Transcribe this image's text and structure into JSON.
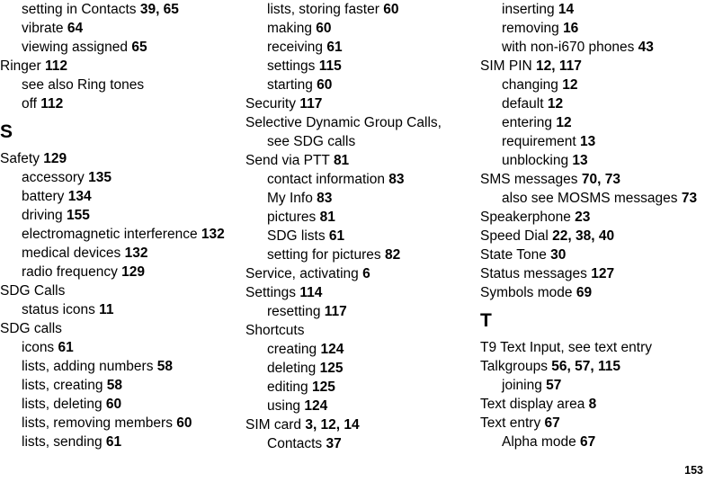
{
  "document": {
    "type": "index",
    "page_number": "153"
  },
  "columns": [
    {
      "name": "column-1",
      "entries": [
        {
          "level": 1,
          "text": "setting in Contacts",
          "pages": "39, 65"
        },
        {
          "level": 1,
          "text": "vibrate",
          "pages": "64"
        },
        {
          "level": 1,
          "text": "viewing assigned",
          "pages": "65"
        },
        {
          "level": 0,
          "text": "Ringer",
          "pages": "112"
        },
        {
          "level": 1,
          "text": "see also Ring tones",
          "pages": ""
        },
        {
          "level": 1,
          "text": "off",
          "pages": "112"
        },
        {
          "heading": "S"
        },
        {
          "level": 0,
          "text": "Safety",
          "pages": "129"
        },
        {
          "level": 1,
          "text": "accessory",
          "pages": "135"
        },
        {
          "level": 1,
          "text": "battery",
          "pages": "134"
        },
        {
          "level": 1,
          "text": "driving",
          "pages": "155"
        },
        {
          "level": 1,
          "text": "electromagnetic interference",
          "pages": "132",
          "wrap": true
        },
        {
          "level": 1,
          "text": "medical devices",
          "pages": "132"
        },
        {
          "level": 1,
          "text": "radio frequency",
          "pages": "129"
        },
        {
          "level": 0,
          "text": "SDG Calls",
          "pages": ""
        },
        {
          "level": 1,
          "text": "status icons",
          "pages": "11"
        },
        {
          "level": 0,
          "text": "SDG calls",
          "pages": ""
        },
        {
          "level": 1,
          "text": "icons",
          "pages": "61"
        },
        {
          "level": 1,
          "text": "lists, adding numbers",
          "pages": "58"
        },
        {
          "level": 1,
          "text": "lists, creating",
          "pages": "58"
        },
        {
          "level": 1,
          "text": "lists, deleting",
          "pages": "60"
        },
        {
          "level": 1,
          "text": "lists, removing members",
          "pages": "60"
        },
        {
          "level": 1,
          "text": "lists, sending",
          "pages": "61"
        }
      ]
    },
    {
      "name": "column-2",
      "entries": [
        {
          "level": 1,
          "text": "lists, storing faster",
          "pages": "60"
        },
        {
          "level": 1,
          "text": "making",
          "pages": "60"
        },
        {
          "level": 1,
          "text": "receiving",
          "pages": "61"
        },
        {
          "level": 1,
          "text": "settings",
          "pages": "115"
        },
        {
          "level": 1,
          "text": "starting",
          "pages": "60"
        },
        {
          "level": 0,
          "text": "Security",
          "pages": "117"
        },
        {
          "level": 0,
          "text": "Selective Dynamic Group Calls, see SDG calls",
          "pages": "",
          "wrap": true
        },
        {
          "level": 0,
          "text": "Send via PTT",
          "pages": "81"
        },
        {
          "level": 1,
          "text": "contact information",
          "pages": "83"
        },
        {
          "level": 1,
          "text": "My Info",
          "pages": "83"
        },
        {
          "level": 1,
          "text": "pictures",
          "pages": "81"
        },
        {
          "level": 1,
          "text": "SDG lists",
          "pages": "61"
        },
        {
          "level": 1,
          "text": "setting for pictures",
          "pages": "82"
        },
        {
          "level": 0,
          "text": "Service, activating",
          "pages": "6"
        },
        {
          "level": 0,
          "text": "Settings",
          "pages": "114"
        },
        {
          "level": 1,
          "text": "resetting",
          "pages": "117"
        },
        {
          "level": 0,
          "text": "Shortcuts",
          "pages": ""
        },
        {
          "level": 1,
          "text": "creating",
          "pages": "124"
        },
        {
          "level": 1,
          "text": "deleting",
          "pages": "125"
        },
        {
          "level": 1,
          "text": "editing",
          "pages": "125"
        },
        {
          "level": 1,
          "text": "using",
          "pages": "124"
        },
        {
          "level": 0,
          "text": "SIM card",
          "pages": "3, 12, 14"
        },
        {
          "level": 1,
          "text": "Contacts",
          "pages": "37"
        }
      ]
    },
    {
      "name": "column-3",
      "entries": [
        {
          "level": 1,
          "text": "inserting",
          "pages": "14"
        },
        {
          "level": 1,
          "text": "removing",
          "pages": "16"
        },
        {
          "level": 1,
          "text": "with non-i670 phones",
          "pages": "43"
        },
        {
          "level": 0,
          "text": "SIM PIN",
          "pages": "12, 117"
        },
        {
          "level": 1,
          "text": "changing",
          "pages": "12"
        },
        {
          "level": 1,
          "text": "default",
          "pages": "12"
        },
        {
          "level": 1,
          "text": "entering",
          "pages": "12"
        },
        {
          "level": 1,
          "text": "requirement",
          "pages": "13"
        },
        {
          "level": 1,
          "text": "unblocking",
          "pages": "13"
        },
        {
          "level": 0,
          "text": "SMS messages",
          "pages": "70, 73"
        },
        {
          "level": 1,
          "text": "also see MOSMS messages",
          "pages": "73",
          "wrap": true
        },
        {
          "level": 0,
          "text": "Speakerphone",
          "pages": "23"
        },
        {
          "level": 0,
          "text": "Speed Dial",
          "pages": "22, 38, 40"
        },
        {
          "level": 0,
          "text": "State Tone",
          "pages": "30"
        },
        {
          "level": 0,
          "text": "Status messages",
          "pages": "127"
        },
        {
          "level": 0,
          "text": "Symbols mode",
          "pages": "69"
        },
        {
          "heading": "T"
        },
        {
          "level": 0,
          "text": "T9 Text Input, see text entry",
          "pages": ""
        },
        {
          "level": 0,
          "text": "Talkgroups",
          "pages": "56, 57, 115"
        },
        {
          "level": 1,
          "text": "joining",
          "pages": "57"
        },
        {
          "level": 0,
          "text": "Text display area",
          "pages": "8"
        },
        {
          "level": 0,
          "text": "Text entry",
          "pages": "67"
        },
        {
          "level": 1,
          "text": "Alpha mode",
          "pages": "67"
        }
      ]
    }
  ]
}
